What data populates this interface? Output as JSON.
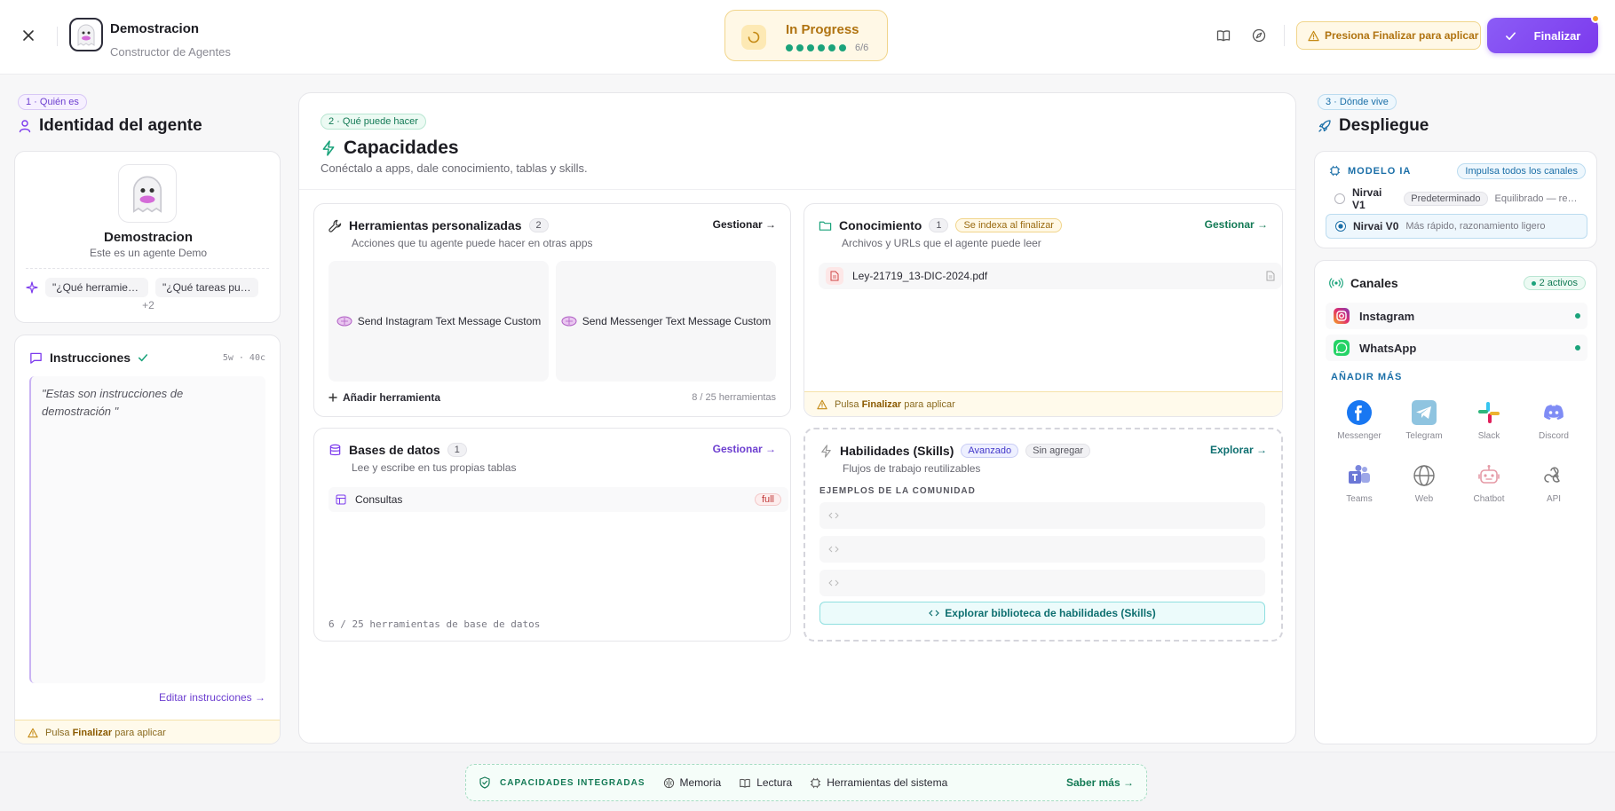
{
  "header": {
    "agent_name": "Demostracion",
    "agent_subtitle": "Constructor de Agentes",
    "progress_label": "In Progress",
    "progress_count": "6/6",
    "warning": "Presiona Finalizar para aplicar",
    "finalize_label": "Finalizar"
  },
  "left": {
    "tag": "1 · Quién es",
    "title": "Identidad del agente",
    "agent_name": "Demostracion",
    "agent_desc": "Este es un agente Demo",
    "chips": [
      "\"¿Qué herramien...",
      "\"¿Qué tareas pue..."
    ],
    "more": "+2",
    "instructions_title": "Instrucciones",
    "instructions_meta": "5w · 40c",
    "instructions_text": "\"Estas son instrucciones de demostración \"",
    "edit_link": "Editar instrucciones →",
    "footer_pre": "Pulsa ",
    "footer_bold": "Finalizar",
    "footer_post": " para aplicar"
  },
  "middle": {
    "tag": "2 · Qué puede hacer",
    "title": "Capacidades",
    "subtitle": "Conéctalo a apps, dale conocimiento, tablas y skills.",
    "tools": {
      "title": "Herramientas personalizadas",
      "count": "2",
      "desc": "Acciones que tu agente puede hacer en otras apps",
      "manage": "Gestionar →",
      "items": [
        "Send Instagram Text Message Custom",
        "Send Messenger Text Message Custom"
      ],
      "add": "Añadir herramienta",
      "limit": "8 / 25 herramientas"
    },
    "knowledge": {
      "title": "Conocimiento",
      "count": "1",
      "index_badge": "Se indexa al finalizar",
      "desc": "Archivos y URLs que el agente puede leer",
      "manage": "Gestionar →",
      "file": "Ley-21719_13-DIC-2024.pdf",
      "footer_pre": "Pulsa ",
      "footer_bold": "Finalizar",
      "footer_post": " para aplicar"
    },
    "databases": {
      "title": "Bases de datos",
      "count": "1",
      "desc": "Lee y escribe en tus propias tablas",
      "manage": "Gestionar →",
      "table": "Consultas",
      "access": "full",
      "limit": "6 / 25 herramientas de base de datos"
    },
    "skills": {
      "title": "Habilidades (Skills)",
      "badge_adv": "Avanzado",
      "badge_none": "Sin agregar",
      "desc": "Flujos de trabajo reutilizables",
      "explore": "Explorar →",
      "community": "EJEMPLOS DE LA COMUNIDAD",
      "explore_btn": "Explorar biblioteca de habilidades (Skills)"
    }
  },
  "right": {
    "tag": "3 · Dónde vive",
    "title": "Despliegue",
    "model_label": "MODELO IA",
    "boost": "Impulsa todos los canales",
    "models": [
      {
        "name": "Nirvai V1",
        "badge": "Predeterminado",
        "desc": "Equilibrado — rec..."
      },
      {
        "name": "Nirvai V0",
        "desc": "Más rápido, razonamiento ligero"
      }
    ],
    "channels_title": "Canales",
    "active": "2 activos",
    "channels": [
      "Instagram",
      "WhatsApp"
    ],
    "add_more": "AÑADIR MÁS",
    "more_channels": [
      "Messenger",
      "Telegram",
      "Slack",
      "Discord",
      "Teams",
      "Web",
      "Chatbot",
      "API"
    ]
  },
  "footer": {
    "label": "CAPACIDADES INTEGRADAS",
    "items": [
      "Memoria",
      "Lectura",
      "Herramientas del sistema"
    ],
    "more": "Saber más →"
  },
  "colors": {
    "accent": "#7c3aed",
    "success": "#1ba37b",
    "warning": "#b07310",
    "info": "#1b6fa8"
  }
}
